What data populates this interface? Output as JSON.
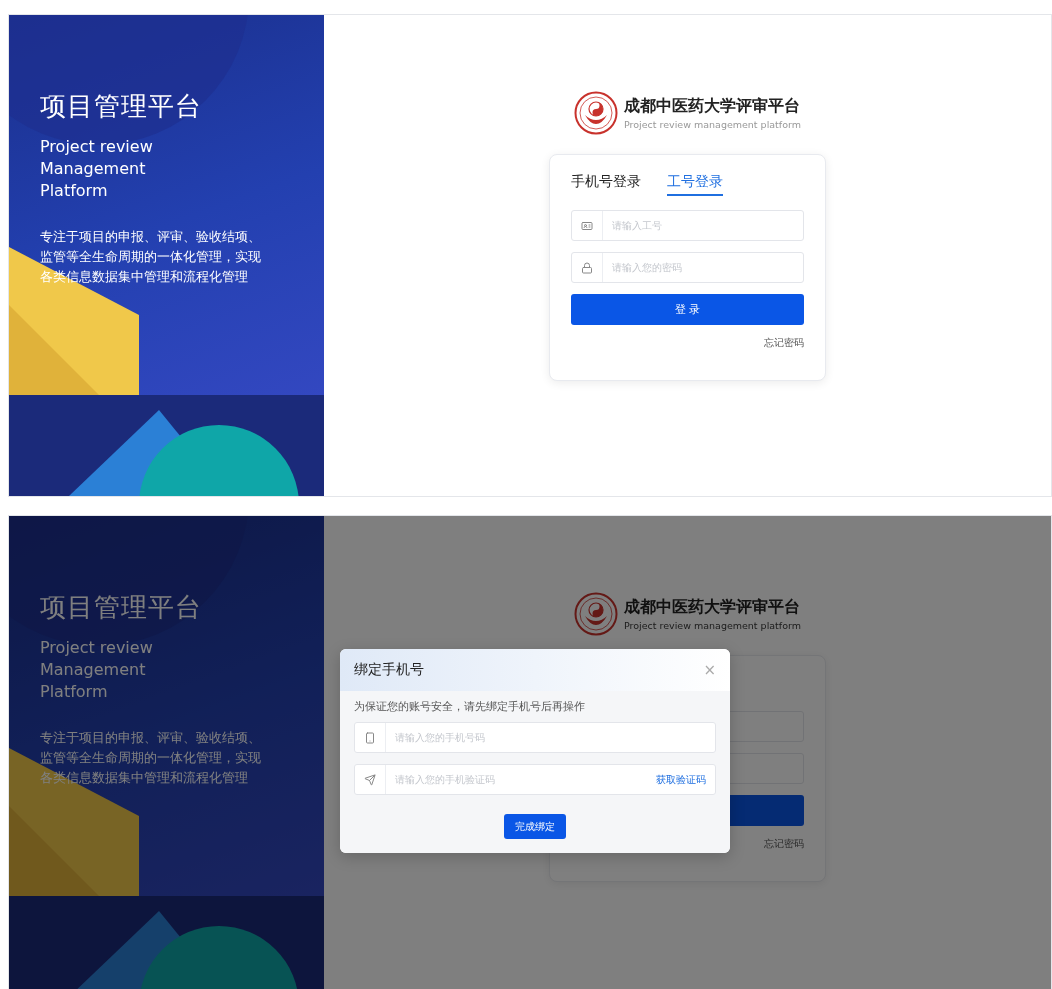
{
  "login_page": {
    "hero": {
      "title": "项目管理平台",
      "subtitle_lines": [
        "Project review",
        "Management",
        "Platform"
      ],
      "description": "专注于项目的申报、评审、验收结项、监管等全生命周期的一体化管理，实现各类信息数据集中管理和流程化管理"
    },
    "brand": {
      "name": "成都中医药大学评审平台",
      "tagline": "Project review management platform"
    },
    "tabs": [
      {
        "label": "手机号登录",
        "selected": false
      },
      {
        "label": "工号登录",
        "selected": true
      }
    ],
    "fields": [
      {
        "kind": "id",
        "placeholder": "请输入工号"
      },
      {
        "kind": "password",
        "placeholder": "请输入您的密码"
      }
    ],
    "submit": "登 录",
    "forgot": "忘记密码"
  },
  "dialog_page": {
    "hero": {
      "title": "项目管理平台",
      "subtitle_lines": [
        "Project review",
        "Management",
        "Platform"
      ],
      "description": "专注于项目的申报、评审、验收结项、监管等全生命周期的一体化管理，实现各类信息数据集中管理和流程化管理"
    },
    "brand": {
      "name": "成都中医药大学评审平台",
      "tagline": "Project review management platform"
    },
    "forgot": "忘记密码",
    "dialog": {
      "title": "绑定手机号",
      "close": "×",
      "hint": "为保证您的账号安全，请先绑定手机号后再操作",
      "fields": [
        {
          "kind": "phone",
          "placeholder": "请输入您的手机号码"
        },
        {
          "kind": "code",
          "placeholder": "请输入您的手机验证码",
          "action": "获取验证码"
        }
      ],
      "submit": "完成绑定"
    }
  }
}
